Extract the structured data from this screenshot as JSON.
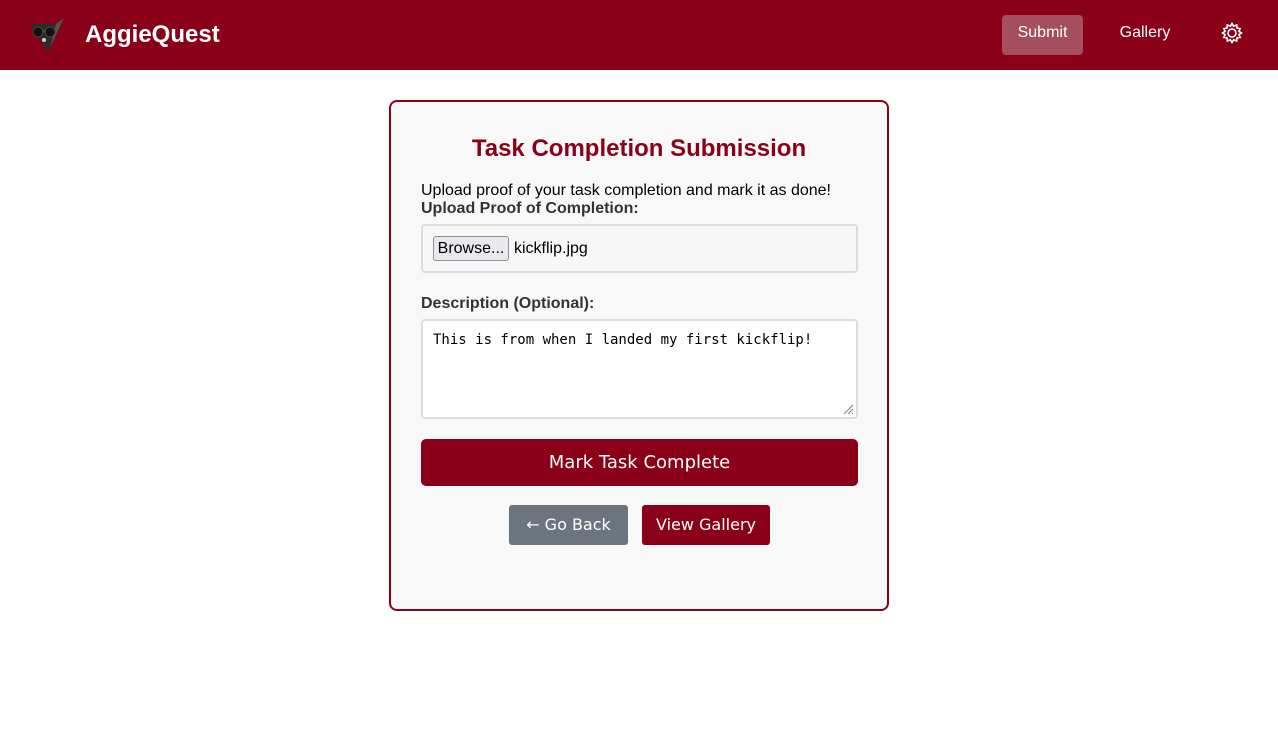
{
  "header": {
    "brand": "AggieQuest",
    "nav": {
      "submit": "Submit",
      "gallery": "Gallery"
    },
    "icons": {
      "logo": "aggie-logo-icon",
      "settings": "gear-icon"
    },
    "colors": {
      "primary": "#8a0019",
      "active_nav": "#a54e5e"
    }
  },
  "card": {
    "title": "Task Completion Submission",
    "intro": "Upload proof of your task completion and mark it as done!",
    "upload": {
      "label": "Upload Proof of Completion:",
      "browse_label": "Browse...",
      "file_name": "kickflip.jpg"
    },
    "description": {
      "label": "Description (Optional):",
      "value": "This is from when I landed my first kickflip!"
    },
    "complete_button": "Mark Task Complete",
    "back_button": "← Go Back",
    "gallery_button": "View Gallery"
  }
}
